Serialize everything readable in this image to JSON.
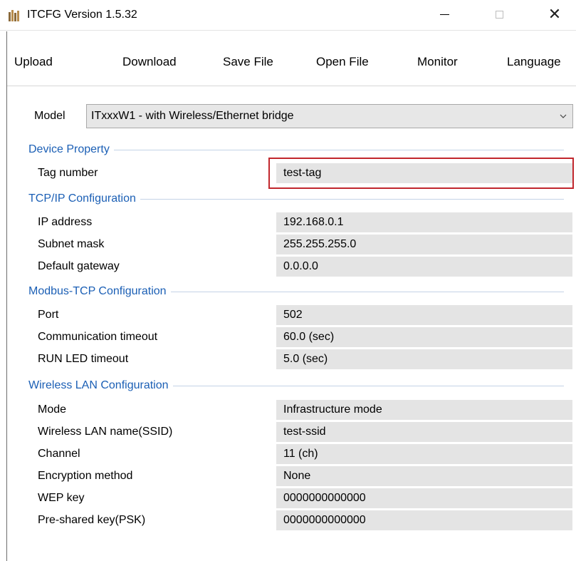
{
  "window": {
    "title": "ITCFG Version 1.5.32",
    "controls": {
      "minimize": "minimize-icon",
      "maximize": "maximize-icon",
      "close": "close-icon"
    }
  },
  "menu": {
    "items": [
      "Upload",
      "Download",
      "Save File",
      "Open File",
      "Monitor",
      "Language"
    ]
  },
  "model": {
    "label": "Model",
    "value": "ITxxxW1 - with Wireless/Ethernet bridge"
  },
  "groups": {
    "device": {
      "title": "Device Property",
      "rows": [
        {
          "label": "Tag number",
          "value": "test-tag"
        }
      ]
    },
    "tcpip": {
      "title": "TCP/IP Configuration",
      "rows": [
        {
          "label": "IP address",
          "value": "192.168.0.1"
        },
        {
          "label": "Subnet mask",
          "value": "255.255.255.0"
        },
        {
          "label": "Default gateway",
          "value": "0.0.0.0"
        }
      ]
    },
    "modbus": {
      "title": "Modbus-TCP Configuration",
      "rows": [
        {
          "label": "Port",
          "value": "502"
        },
        {
          "label": "Communication timeout",
          "value": "60.0 (sec)"
        },
        {
          "label": "RUN LED timeout",
          "value": "5.0 (sec)"
        }
      ]
    },
    "wlan": {
      "title": "Wireless LAN Configuration",
      "rows": [
        {
          "label": "Mode",
          "value": "Infrastructure mode"
        },
        {
          "label": "Wireless LAN name(SSID)",
          "value": "test-ssid"
        },
        {
          "label": "Channel",
          "value": "11 (ch)"
        },
        {
          "label": "Encryption method",
          "value": "None"
        },
        {
          "label": "WEP key",
          "value": "0000000000000"
        },
        {
          "label": "Pre-shared key(PSK)",
          "value": "0000000000000"
        }
      ]
    }
  },
  "colors": {
    "group_title": "#1b5fb5",
    "value_field": "#e4e4e4",
    "highlight_border": "#c1272d"
  }
}
